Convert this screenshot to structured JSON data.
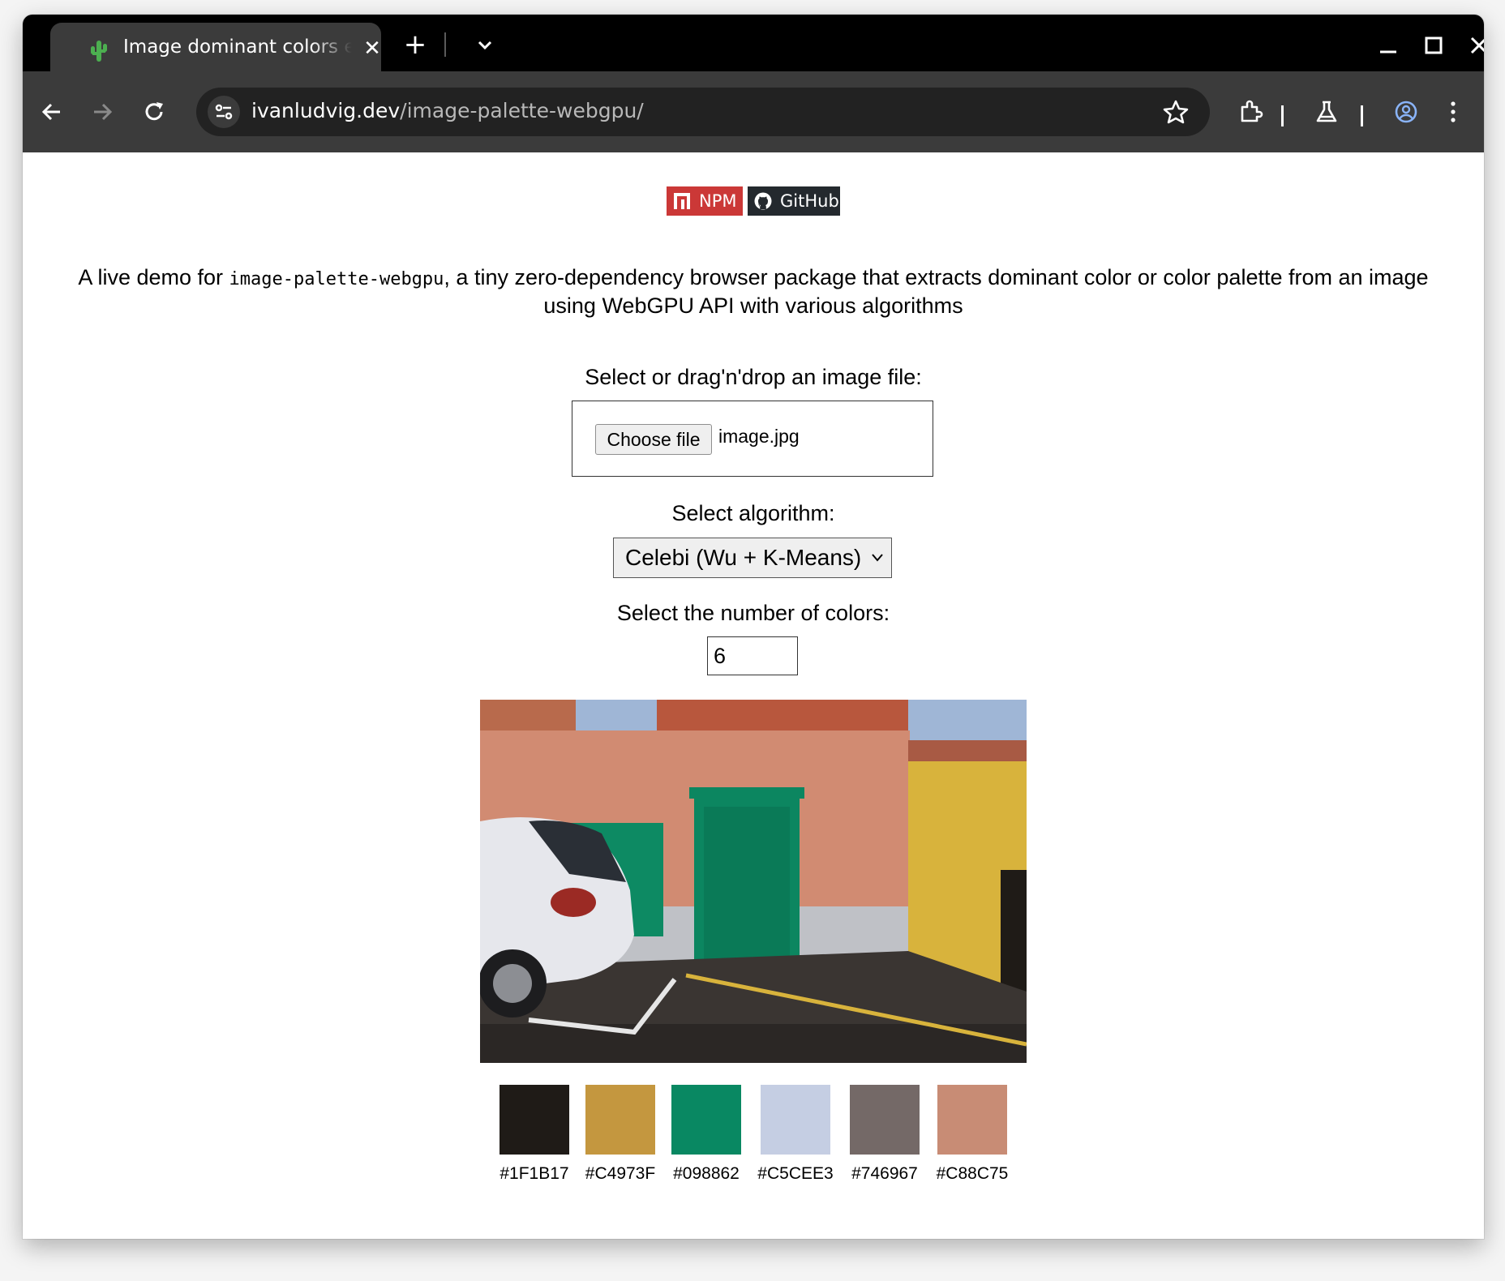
{
  "browser": {
    "tab": {
      "title": "Image dominant colors extractor"
    },
    "address": {
      "host": "ivanludvig.dev",
      "path": "/image-palette-webgpu/"
    }
  },
  "page": {
    "badges": {
      "npm": "NPM",
      "github": "GitHub"
    },
    "intro": {
      "before": "A live demo for ",
      "package": "image-palette-webgpu",
      "after": ", a tiny zero-dependency browser package that extracts dominant color or color palette from an image using WebGPU API with various algorithms"
    },
    "file": {
      "label": "Select or drag'n'drop an image file:",
      "button": "Choose file",
      "name": "image.jpg"
    },
    "algorithm": {
      "label": "Select algorithm:",
      "selected": "Celebi (Wu + K-Means)"
    },
    "colors": {
      "label": "Select the number of colors:",
      "value": "6"
    },
    "palette": [
      {
        "hex": "#1F1B17",
        "label": "#1F1B17"
      },
      {
        "hex": "#C4973F",
        "label": "#C4973F"
      },
      {
        "hex": "#098862",
        "label": "#098862"
      },
      {
        "hex": "#C5CEE3",
        "label": "#C5CEE3"
      },
      {
        "hex": "#746967",
        "label": "#746967"
      },
      {
        "hex": "#C88C75",
        "label": "#C88C75"
      }
    ]
  },
  "colors": {
    "npm_red": "#cb3837",
    "github_dark": "#24292e",
    "tab_strip": "#000000",
    "toolbar": "#3b3b3b"
  }
}
